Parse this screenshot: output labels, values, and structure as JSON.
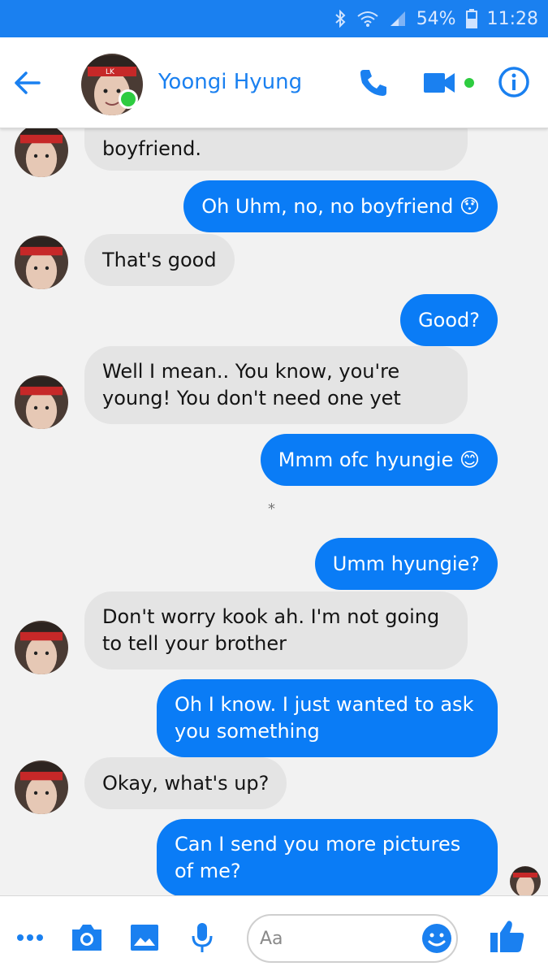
{
  "status_bar": {
    "battery": "54%",
    "time": "11:28",
    "icons": [
      "bluetooth-icon",
      "wifi-icon",
      "signal-icon",
      "battery-icon"
    ]
  },
  "header": {
    "contact_name": "Yoongi Hyung",
    "icons": [
      "back-arrow-icon",
      "phone-icon",
      "video-camera-icon",
      "info-icon"
    ]
  },
  "messages": [
    {
      "from": "them",
      "text": "boyfriend."
    },
    {
      "from": "me",
      "text": "Oh Uhm, no, no boyfriend 😯"
    },
    {
      "from": "them",
      "text": "That's good"
    },
    {
      "from": "me",
      "text": "Good?"
    },
    {
      "from": "them",
      "text": "Well I mean.. You know, you're young! You don't need one yet"
    },
    {
      "from": "me",
      "text": "Mmm ofc hyungie 😊"
    },
    {
      "from": "divider",
      "text": "*"
    },
    {
      "from": "me",
      "text": "Umm hyungie?"
    },
    {
      "from": "them",
      "text": "Don't worry kook ah. I'm not going to tell your brother"
    },
    {
      "from": "me",
      "text": "Oh I know. I just wanted to ask you something"
    },
    {
      "from": "them",
      "text": "Okay, what's up?"
    },
    {
      "from": "me",
      "text": "Can I send you more pictures of me?"
    }
  ],
  "composer": {
    "placeholder": "Aa",
    "icons": [
      "more-icon",
      "camera-icon",
      "gallery-icon",
      "microphone-icon",
      "emoji-icon",
      "thumbs-up-icon"
    ]
  },
  "colors": {
    "accent": "#0a7cf6",
    "status_bar": "#1a80f0",
    "incoming_bubble": "#e4e4e4",
    "online": "#2ecc40"
  }
}
